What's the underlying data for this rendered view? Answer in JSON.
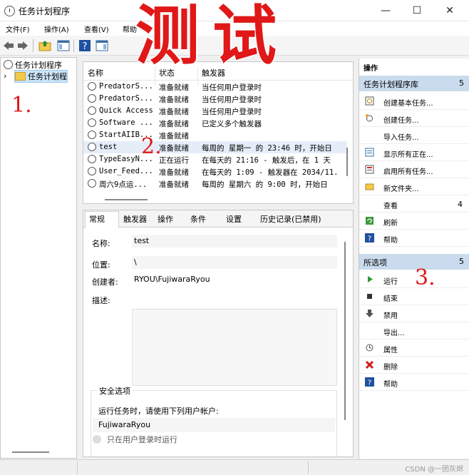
{
  "window": {
    "title": "任务计划程序",
    "minimize": "—",
    "maximize": "☐",
    "close": "✕"
  },
  "menu": [
    "文件(F)",
    "操作(A)",
    "查看(V)",
    "帮助"
  ],
  "overlay": {
    "big_text": "测试",
    "step1": "1.",
    "step2": "2.",
    "step3": "3."
  },
  "tree": {
    "root": "任务计划程序",
    "library": "任务计划程"
  },
  "task_list": {
    "columns": [
      "名称",
      "状态",
      "触发器"
    ],
    "rows": [
      {
        "name": "PredatorS...",
        "status": "准备就绪",
        "trigger": "当任何用户登录时"
      },
      {
        "name": "PredatorS...",
        "status": "准备就绪",
        "trigger": "当任何用户登录时"
      },
      {
        "name": "Quick Access",
        "status": "准备就绪",
        "trigger": "当任何用户登录时"
      },
      {
        "name": "Software ...",
        "status": "准备就绪",
        "trigger": "已定义多个触发器"
      },
      {
        "name": "StartAIIB...",
        "status": "准备就绪",
        "trigger": ""
      },
      {
        "name": "test",
        "status": "准备就绪",
        "trigger": "每周的 星期一 的 23:46 时，开始日"
      },
      {
        "name": "TypeEasyN...",
        "status": "正在运行",
        "trigger": "在每天的 21:16 - 触发后，在 1 天"
      },
      {
        "name": "User_Feed...",
        "status": "准备就绪",
        "trigger": "在每天的 1:09 - 触发器在 2034/11."
      },
      {
        "name": "周六9点运...",
        "status": "准备就绪",
        "trigger": "每周的 星期六 的 9:00 时，开始日"
      }
    ]
  },
  "detail": {
    "tabs": [
      "常规",
      "触发器",
      "操作",
      "条件",
      "设置",
      "历史记录(已禁用)"
    ],
    "name_label": "名称:",
    "name_value": "test",
    "location_label": "位置:",
    "location_value": "\\",
    "author_label": "创建者:",
    "author_value": "RYOU\\FujiwaraRyou",
    "desc_label": "描述:",
    "security_title": "安全选项",
    "run_as_label": "运行任务时，请使用下列用户帐户:",
    "run_as_value": "FujiwaraRyou",
    "only_logged_on": "只在用户登录时运行"
  },
  "actions": {
    "top": "操作",
    "section1": {
      "title": "任务计划程序库",
      "count": "5"
    },
    "items1": [
      {
        "label": "创建基本任务...",
        "icon": "wizard-icon"
      },
      {
        "label": "创建任务...",
        "icon": "create-task-icon"
      },
      {
        "label": "导入任务...",
        "icon": ""
      },
      {
        "label": "显示所有正在...",
        "icon": "running-tasks-icon"
      },
      {
        "label": "启用所有任务...",
        "icon": "history-icon"
      },
      {
        "label": "新文件夹...",
        "icon": "folder-icon"
      },
      {
        "label": "查看",
        "icon": "",
        "count": "4"
      },
      {
        "label": "刷新",
        "icon": "refresh-icon"
      },
      {
        "label": "帮助",
        "icon": "help-icon"
      }
    ],
    "section2": {
      "title": "所选项",
      "count": "5"
    },
    "items2": [
      {
        "label": "运行",
        "icon": "run-icon"
      },
      {
        "label": "结束",
        "icon": "stop-icon"
      },
      {
        "label": "禁用",
        "icon": "disable-icon"
      },
      {
        "label": "导出...",
        "icon": ""
      },
      {
        "label": "属性",
        "icon": "properties-icon"
      },
      {
        "label": "删除",
        "icon": "delete-icon"
      },
      {
        "label": "帮助",
        "icon": "help-icon"
      }
    ]
  },
  "statusbar": {
    "watermark": "CSDN @一团灰烬"
  }
}
